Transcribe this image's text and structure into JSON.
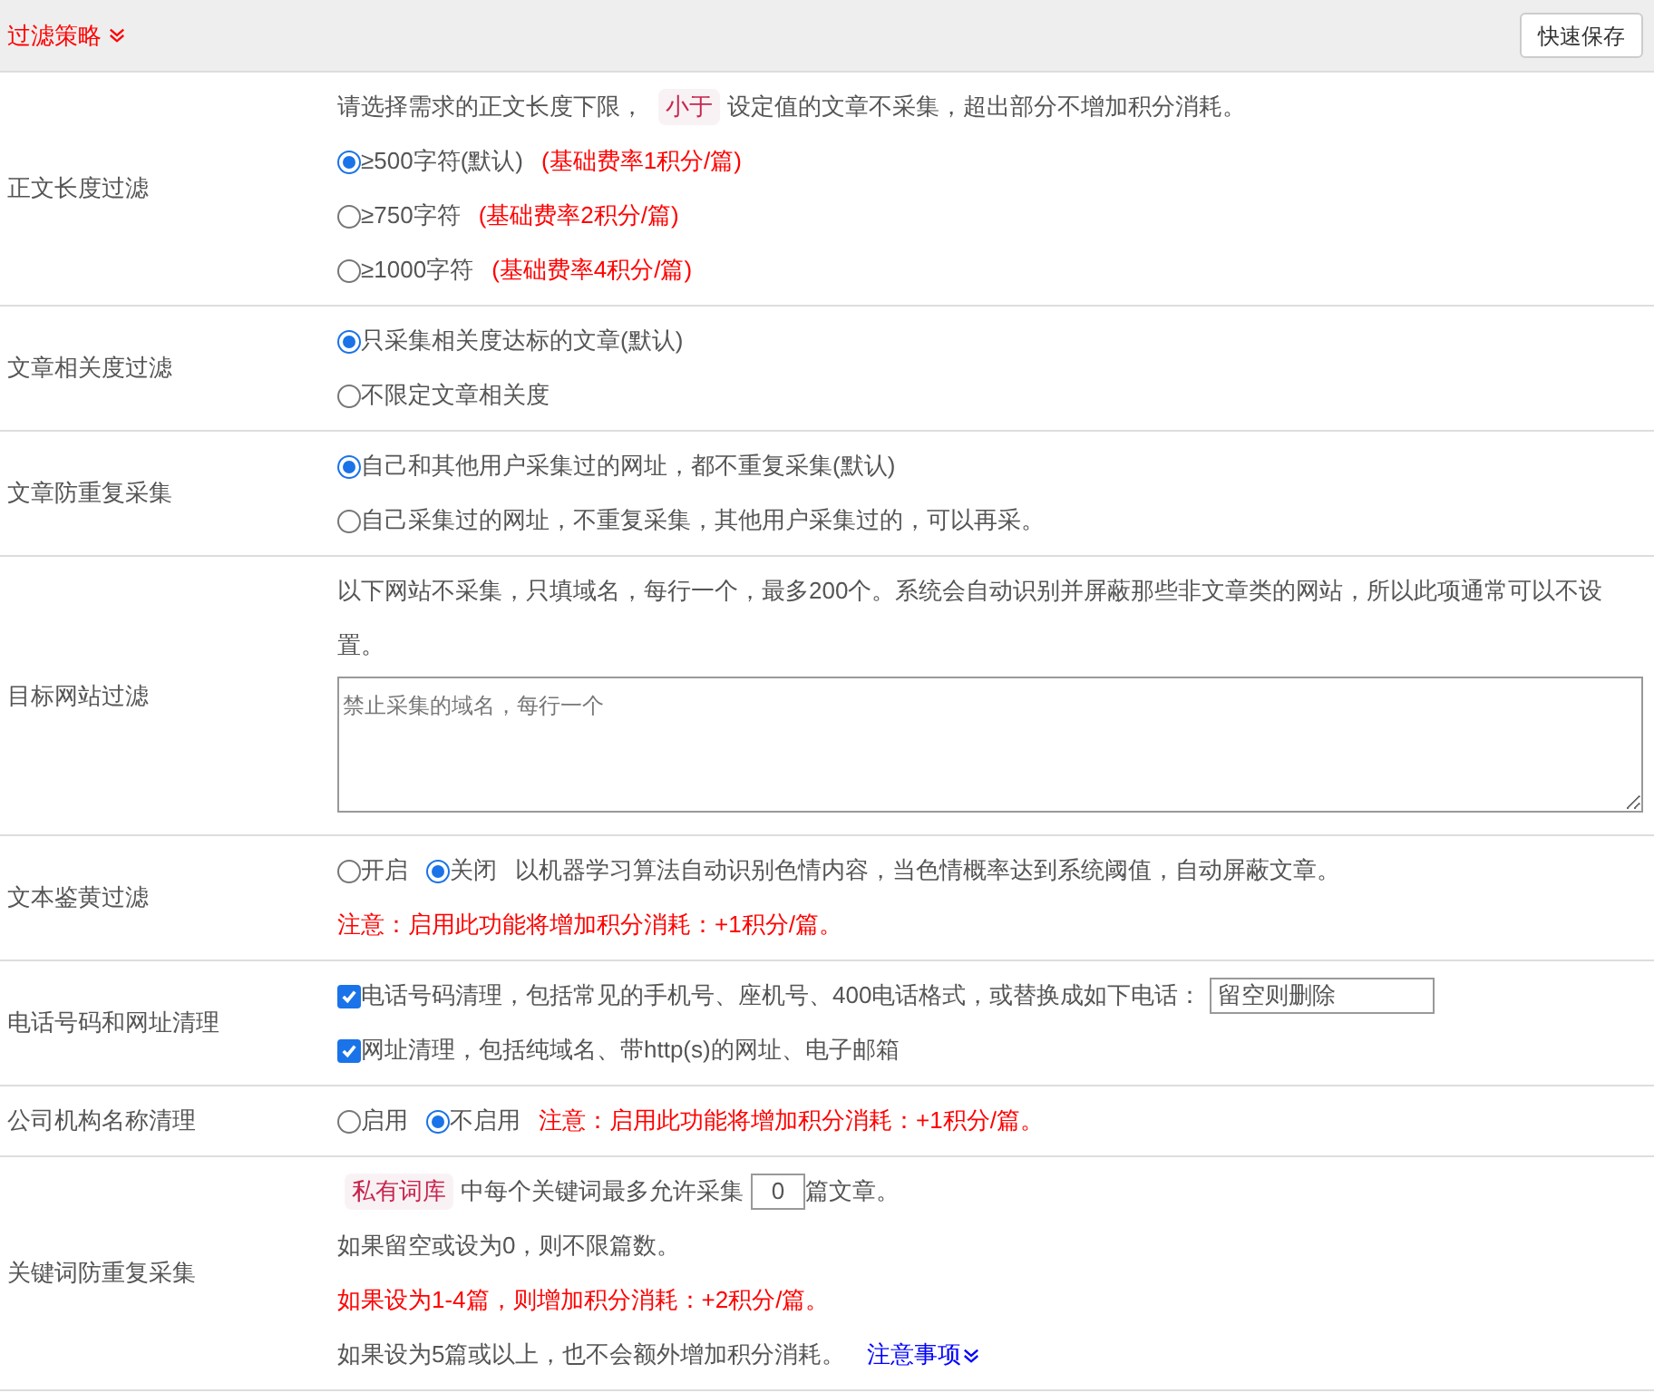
{
  "header": {
    "title": "过滤策略",
    "button": "快速保存"
  },
  "rows": [
    {
      "label": "正文长度过滤",
      "lines": [
        [
          {
            "kind": "text",
            "text": "请选择需求的正文长度下限，"
          },
          {
            "kind": "tag",
            "text": "小于"
          },
          {
            "kind": "text",
            "text": "设定值的文章不采集，超出部分不增加积分消耗。"
          }
        ],
        [
          {
            "kind": "radio",
            "label": "≥500字符(默认)",
            "selected": true
          },
          {
            "kind": "warning",
            "text": "(基础费率1积分/篇)"
          }
        ],
        [
          {
            "kind": "radio",
            "label": "≥750字符",
            "selected": false
          },
          {
            "kind": "warning",
            "text": "(基础费率2积分/篇)"
          }
        ],
        [
          {
            "kind": "radio",
            "label": "≥1000字符",
            "selected": false
          },
          {
            "kind": "warning",
            "text": "(基础费率4积分/篇)"
          }
        ]
      ]
    },
    {
      "label": "文章相关度过滤",
      "lines": [
        [
          {
            "kind": "radio",
            "label": "只采集相关度达标的文章(默认)",
            "selected": true
          }
        ],
        [
          {
            "kind": "radio",
            "label": "不限定文章相关度",
            "selected": false
          }
        ]
      ]
    },
    {
      "label": "文章防重复采集",
      "lines": [
        [
          {
            "kind": "radio",
            "label": "自己和其他用户采集过的网址，都不重复采集(默认)",
            "selected": true
          }
        ],
        [
          {
            "kind": "radio",
            "label": "自己采集过的网址，不重复采集，其他用户采集过的，可以再采。",
            "selected": false
          }
        ]
      ]
    },
    {
      "label": "目标网站过滤",
      "lines": [
        [
          {
            "kind": "text",
            "text": "以下网站不采集，只填域名，每行一个，最多200个。系统会自动识别并屏蔽那些非文章类的网站，所以此项通常可以不设置。"
          }
        ],
        [
          {
            "kind": "textarea",
            "placeholder": "禁止采集的域名，每行一个"
          }
        ]
      ]
    },
    {
      "label": "文本鉴黄过滤",
      "lines": [
        [
          {
            "kind": "radio",
            "label": "开启",
            "selected": false
          },
          {
            "kind": "radio",
            "label": "关闭",
            "selected": true
          },
          {
            "kind": "text",
            "text": "以机器学习算法自动识别色情内容，当色情概率达到系统阈值，自动屏蔽文章。"
          }
        ],
        [
          {
            "kind": "warning",
            "text": "注意：启用此功能将增加积分消耗：+1积分/篇。"
          }
        ]
      ]
    },
    {
      "label": "电话号码和网址清理",
      "lines": [
        [
          {
            "kind": "checkbox",
            "label": "电话号码清理，包括常见的手机号、座机号、400电话格式，或替换成如下电话：",
            "checked": true
          },
          {
            "kind": "input",
            "placeholder": "留空则删除"
          }
        ],
        [
          {
            "kind": "checkbox",
            "label": "网址清理，包括纯域名、带http(s)的网址、电子邮箱",
            "checked": true
          }
        ]
      ]
    },
    {
      "label": "公司机构名称清理",
      "lines": [
        [
          {
            "kind": "radio",
            "label": "启用",
            "selected": false
          },
          {
            "kind": "radio",
            "label": "不启用",
            "selected": true
          },
          {
            "kind": "warning",
            "text": "注意：启用此功能将增加积分消耗：+1积分/篇。"
          }
        ]
      ]
    },
    {
      "label": "关键词防重复采集",
      "lines": [
        [
          {
            "kind": "tag",
            "text": "私有词库"
          },
          {
            "kind": "text",
            "text": "中每个关键词最多允许采集"
          },
          {
            "kind": "number",
            "value": "0"
          },
          {
            "kind": "text",
            "text": "篇文章。"
          }
        ],
        [
          {
            "kind": "text",
            "text": "如果留空或设为0，则不限篇数。"
          }
        ],
        [
          {
            "kind": "warning",
            "text": "如果设为1-4篇，则增加积分消耗：+2积分/篇。"
          }
        ],
        [
          {
            "kind": "text",
            "text": "如果设为5篇或以上，也不会额外增加积分消耗。"
          },
          {
            "kind": "link",
            "text": "注意事项"
          }
        ]
      ]
    }
  ]
}
